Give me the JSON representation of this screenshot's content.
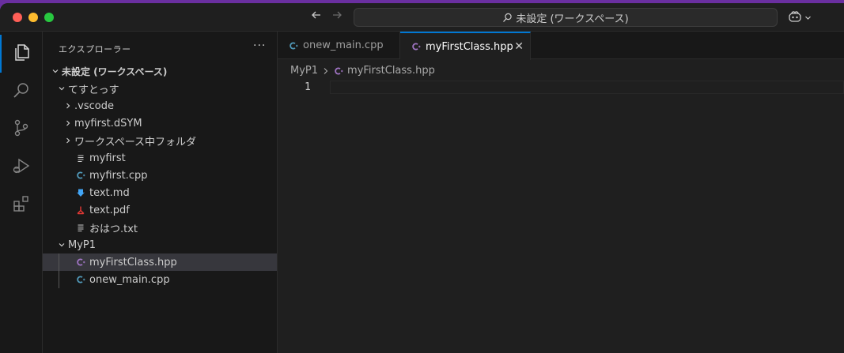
{
  "titlebar": {
    "command_center": "未設定 (ワークスペース)"
  },
  "sidebar": {
    "title": "エクスプローラー",
    "more": "···",
    "tree": [
      {
        "label": "未設定 (ワークスペース)",
        "indent": 0,
        "chevron": "down",
        "icon": "",
        "bold": true
      },
      {
        "label": "てすとっす",
        "indent": 1,
        "chevron": "down",
        "icon": ""
      },
      {
        "label": ".vscode",
        "indent": 2,
        "chevron": "right",
        "icon": ""
      },
      {
        "label": "myfirst.dSYM",
        "indent": 2,
        "chevron": "right",
        "icon": ""
      },
      {
        "label": "ワークスペース中フォルダ",
        "indent": 2,
        "chevron": "right",
        "icon": ""
      },
      {
        "label": "myfirst",
        "indent": 2,
        "chevron": "",
        "icon": "lines-icon"
      },
      {
        "label": "myfirst.cpp",
        "indent": 2,
        "chevron": "",
        "icon": "cpp-icon"
      },
      {
        "label": "text.md",
        "indent": 2,
        "chevron": "",
        "icon": "markdown-icon"
      },
      {
        "label": "text.pdf",
        "indent": 2,
        "chevron": "",
        "icon": "pdf-icon"
      },
      {
        "label": "おはつ.txt",
        "indent": 2,
        "chevron": "",
        "icon": "lines-icon"
      },
      {
        "label": "MyP1",
        "indent": 1,
        "chevron": "down",
        "icon": ""
      },
      {
        "label": "myFirstClass.hpp",
        "indent": 2,
        "chevron": "",
        "icon": "hpp-icon",
        "selected": true,
        "guide": true
      },
      {
        "label": "onew_main.cpp",
        "indent": 2,
        "chevron": "",
        "icon": "cpp-icon",
        "guide": true
      }
    ]
  },
  "editor": {
    "tabs": [
      {
        "label": "onew_main.cpp",
        "icon": "cpp-icon",
        "active": false
      },
      {
        "label": "myFirstClass.hpp",
        "icon": "hpp-icon",
        "active": true,
        "close": "✕"
      }
    ],
    "breadcrumb": {
      "folder": "MyP1",
      "file": "myFirstClass.hpp"
    },
    "line_number": "1"
  },
  "colors": {
    "accent": "#0078d4",
    "cpp": "#519aba",
    "hpp": "#a074c4",
    "markdown": "#42a5f5",
    "pdf": "#e53935"
  }
}
